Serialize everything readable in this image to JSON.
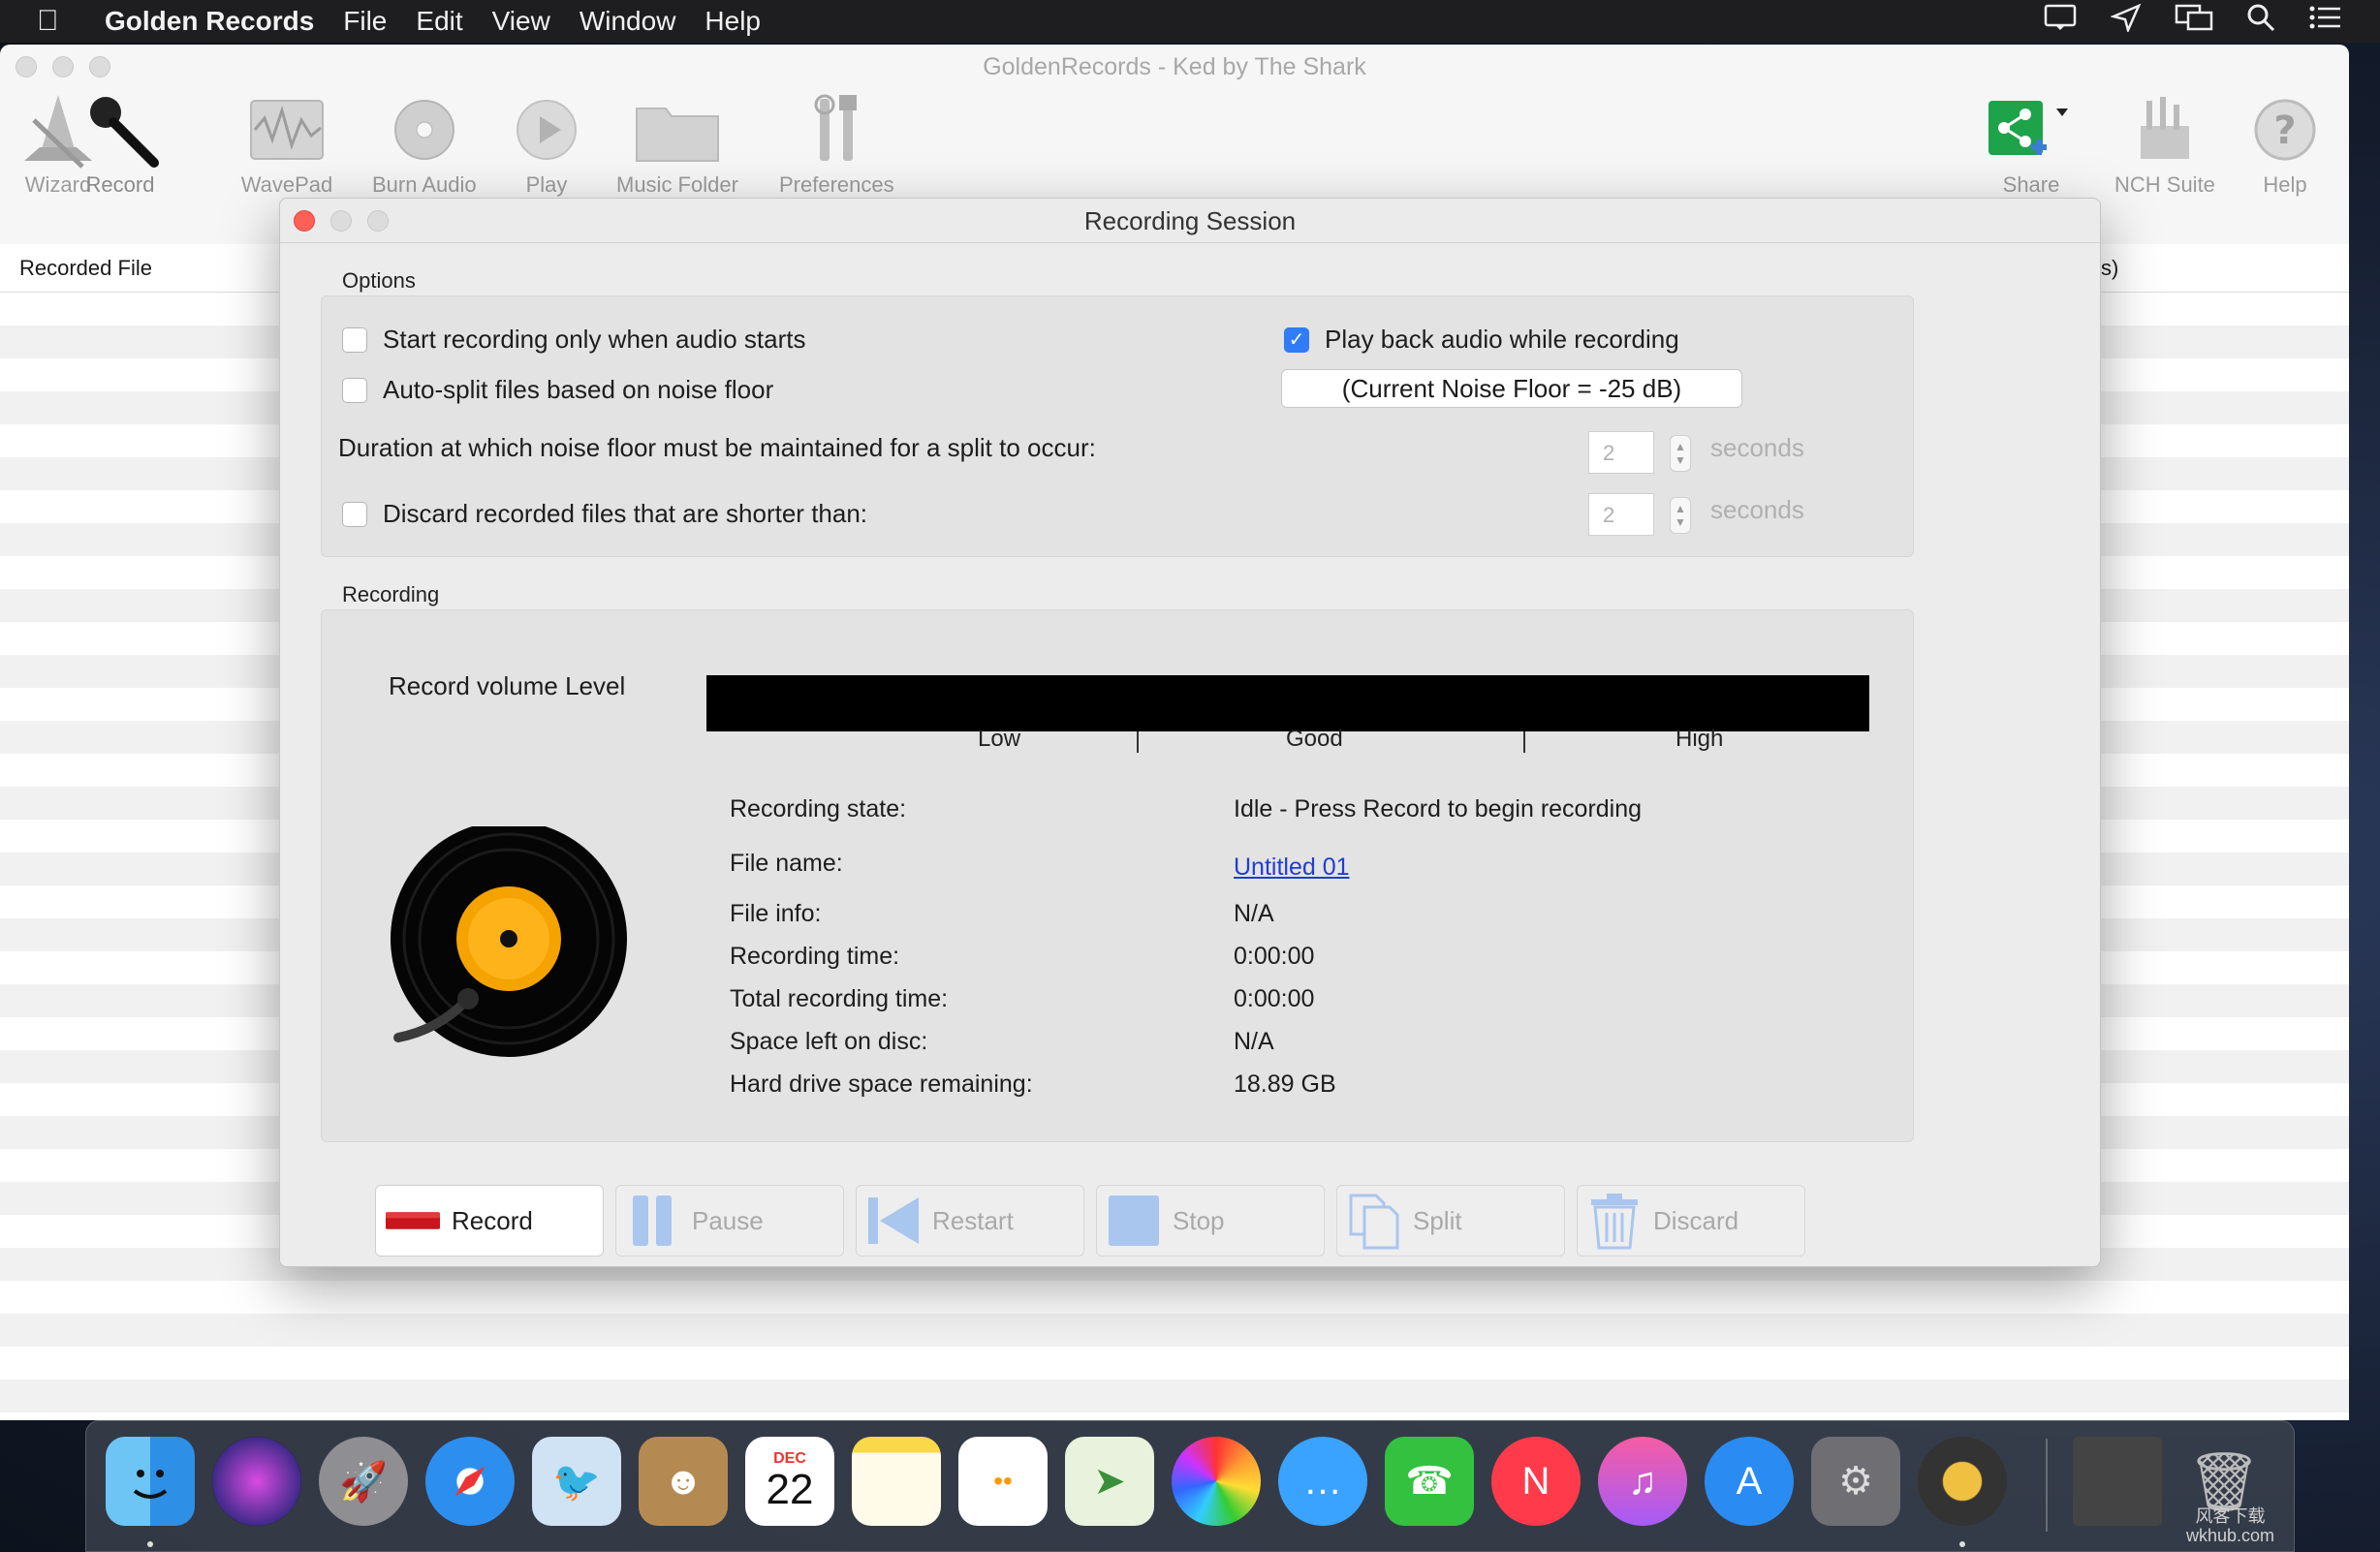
{
  "menubar": {
    "app_name": "Golden Records",
    "items": [
      "File",
      "Edit",
      "View",
      "Window",
      "Help"
    ]
  },
  "main_window": {
    "title": "GoldenRecords - Ked by The Shark",
    "toolbar": {
      "wizard": "Wizard",
      "record": "Record",
      "wavepad": "WavePad",
      "burn_audio": "Burn Audio",
      "play": "Play",
      "music_folder": "Music Folder",
      "preferences": "Preferences",
      "share": "Share",
      "nch_suite": "NCH Suite",
      "help": "Help"
    },
    "list_header": {
      "recorded_file": "Recorded File",
      "partial_col": "s)"
    }
  },
  "dialog": {
    "title": "Recording Session",
    "options_label": "Options",
    "options": {
      "start_on_audio": "Start recording only when audio starts",
      "start_on_audio_checked": false,
      "auto_split": "Auto-split files based on noise floor",
      "auto_split_checked": false,
      "playback": "Play back audio while recording",
      "playback_checked": true,
      "noise_floor": "(Current Noise Floor = -25 dB)",
      "duration_label": "Duration at which noise floor must be maintained for a split to occur:",
      "duration_value": "2",
      "duration_unit": "seconds",
      "discard_short": "Discard recorded files that are shorter than:",
      "discard_short_checked": false,
      "discard_value": "2",
      "discard_unit": "seconds"
    },
    "recording_label": "Recording",
    "recording": {
      "volume_label": "Record volume Level",
      "meter_low": "Low",
      "meter_good": "Good",
      "meter_high": "High",
      "state_label": "Recording state:",
      "state_value": "Idle - Press Record to begin recording",
      "file_name_label": "File name:",
      "file_name_value": "Untitled 01",
      "file_info_label": "File info:",
      "file_info_value": "N/A",
      "recording_time_label": "Recording time:",
      "recording_time_value": "0:00:00",
      "total_time_label": "Total recording time:",
      "total_time_value": "0:00:00",
      "space_disc_label": "Space left on disc:",
      "space_disc_value": "N/A",
      "hd_space_label": "Hard drive space remaining:",
      "hd_space_value": "18.89 GB"
    },
    "buttons": {
      "record": "Record",
      "pause": "Pause",
      "restart": "Restart",
      "stop": "Stop",
      "split": "Split",
      "discard": "Discard"
    }
  },
  "dock": {
    "calendar_month": "DEC",
    "calendar_day": "22",
    "watermark": "风客下载\nwkhub.com"
  }
}
